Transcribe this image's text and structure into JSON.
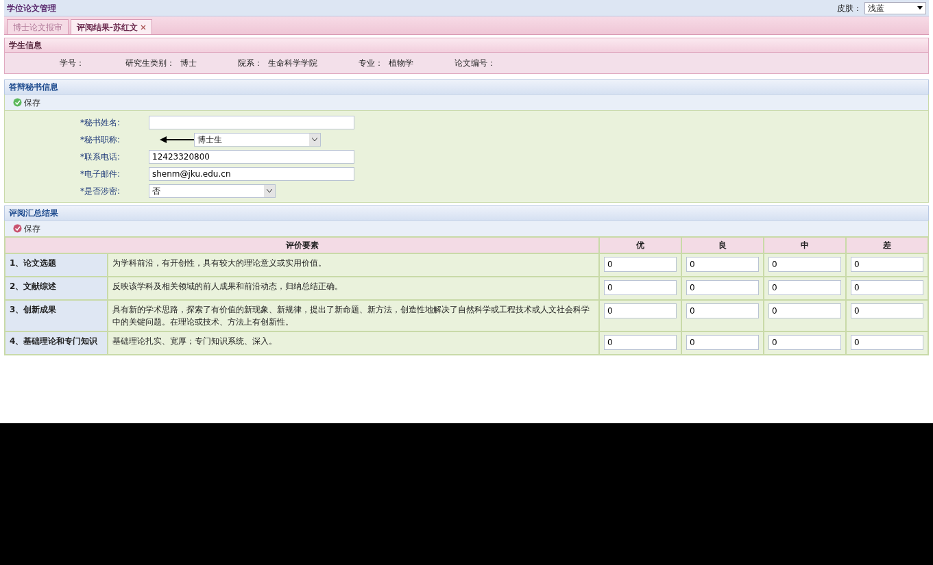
{
  "app_title": "学位论文管理",
  "skin": {
    "label": "皮肤：",
    "value": "浅蓝"
  },
  "tabs": [
    {
      "label": "博士论文报审",
      "selected": false,
      "closable": false
    },
    {
      "label": "评阅结果-苏红文",
      "selected": true,
      "closable": true
    }
  ],
  "student_panel": {
    "title": "学生信息",
    "fields": [
      {
        "label": "学号："
      },
      {
        "label": "研究生类别：",
        "value": "博士"
      },
      {
        "label": "院系：",
        "value": "生命科学学院"
      },
      {
        "label": "专业：",
        "value": "植物学"
      },
      {
        "label": "论文编号："
      }
    ]
  },
  "secretary_panel": {
    "title": "答辩秘书信息",
    "save": "保存",
    "fields": [
      {
        "kind": "text",
        "label": "*秘书姓名:"
      },
      {
        "kind": "select",
        "label": "*秘书职称:",
        "value": "博士生",
        "pointed": true
      },
      {
        "kind": "text",
        "label": "*联系电话:",
        "value": "12423320800"
      },
      {
        "kind": "text",
        "label": "*电子邮件:",
        "value": "shenm@jku.edu.cn"
      },
      {
        "kind": "select",
        "label": "*是否涉密:",
        "value": "否"
      }
    ]
  },
  "summary_panel": {
    "title": "评阅汇总结果",
    "save": "保存",
    "columns": [
      "评价要素",
      "优",
      "良",
      "中",
      "差"
    ],
    "rows": [
      {
        "item": "1、论文选题",
        "description": "为学科前沿，有开创性，具有较大的理论意义或实用价值。",
        "scores": [
          "0",
          "0",
          "0",
          "0"
        ]
      },
      {
        "item": "2、文献综述",
        "description": "反映该学科及相关领域的前人成果和前沿动态，归纳总结正确。",
        "scores": [
          "0",
          "0",
          "0",
          "0"
        ]
      },
      {
        "item": "3、创新成果",
        "description": "具有新的学术思路，探索了有价值的新现象、新规律，提出了新命题、新方法，创造性地解决了自然科学或工程技术或人文社会科学中的关键问题。在理论或技术、方法上有创新性。",
        "scores": [
          "0",
          "0",
          "0",
          "0"
        ]
      },
      {
        "item": "4、基础理论和专门知识",
        "description": "基础理论扎实、宽厚；专门知识系统、深入。",
        "scores": [
          "0",
          "0",
          "0",
          "0"
        ]
      }
    ]
  }
}
